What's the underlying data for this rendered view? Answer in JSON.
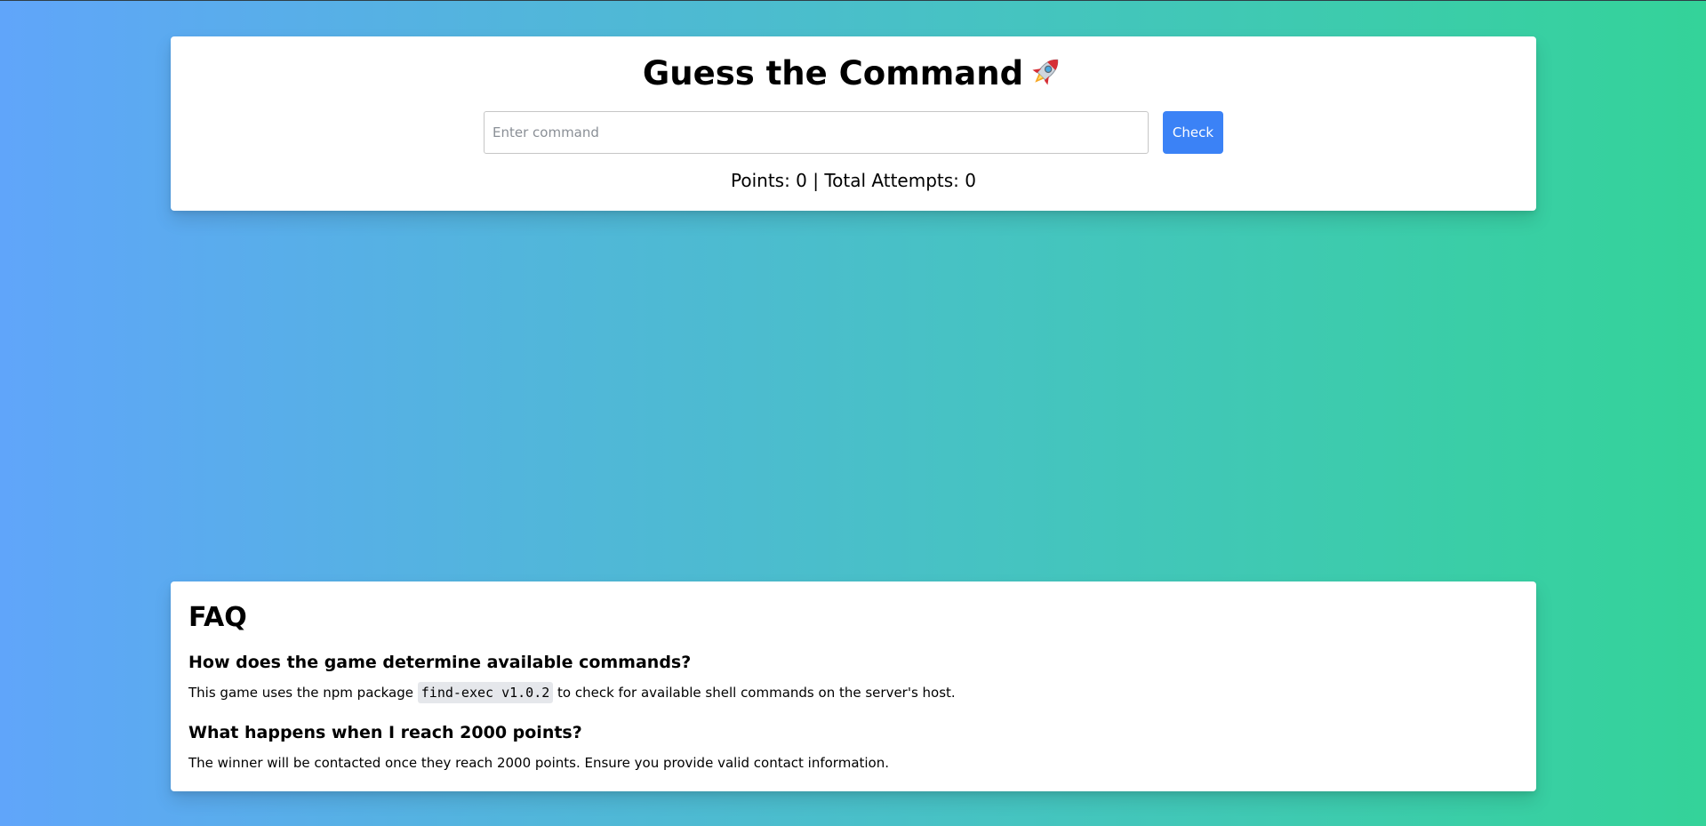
{
  "game": {
    "title": "Guess the Command",
    "title_icon": "rocket-icon",
    "input_placeholder": "Enter command",
    "input_value": "",
    "check_label": "Check",
    "score_text": "Points: 0 | Total Attempts: 0",
    "points": 0,
    "total_attempts": 0
  },
  "faq": {
    "title": "FAQ",
    "items": [
      {
        "question": "How does the game determine available commands?",
        "answer_before": "This game uses the npm package ",
        "answer_code": "find-exec v1.0.2",
        "answer_after": " to check for available shell commands on the server's host."
      },
      {
        "question": "What happens when I reach 2000 points?",
        "answer": "The winner will be contacted once they reach 2000 points. Ensure you provide valid contact information."
      }
    ]
  },
  "colors": {
    "gradient_start": "#60a5fa",
    "gradient_end": "#34d399",
    "button": "#3b82f6",
    "card": "#ffffff",
    "code_bg": "#e5e7eb"
  }
}
